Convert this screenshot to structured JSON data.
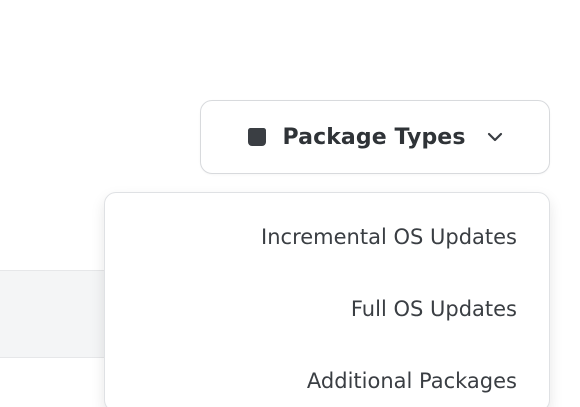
{
  "toggle": {
    "icon": "package-icon",
    "label": "Package Types",
    "chevron": "chevron-down-icon"
  },
  "menu": {
    "items": [
      {
        "label": "Incremental OS Updates"
      },
      {
        "label": "Full OS Updates"
      },
      {
        "label": "Additional Packages"
      }
    ]
  },
  "colors": {
    "text": "#2f3337",
    "border": "#d8dadd",
    "panel": "#f4f5f6"
  }
}
